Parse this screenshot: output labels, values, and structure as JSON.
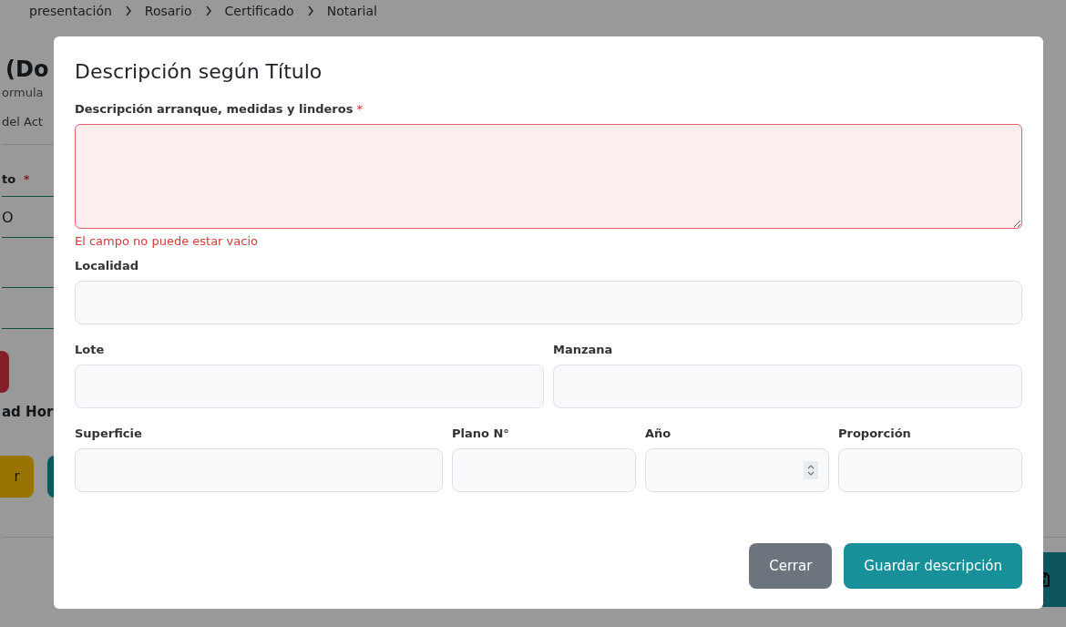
{
  "background_page": {
    "breadcrumb": [
      "presentación",
      "Rosario",
      "Certificado",
      "Notarial"
    ],
    "heading": "(Do",
    "subtitle": "ormula",
    "tab": "del Act",
    "field_label": "to",
    "field_required_mark": "*",
    "field_value": "O",
    "section_title": "ad Hor",
    "button_text": "r"
  },
  "modal": {
    "title": "Descripción según Título",
    "rows": [
      [
        {
          "label": "Descripción arranque, medidas y linderos",
          "required_mark": "*",
          "kind": "textarea",
          "invalid": true,
          "error": "El campo no puede estar vacio"
        }
      ],
      [
        {
          "label": "Localidad",
          "kind": "text",
          "invalid": false
        }
      ],
      [
        {
          "label": "Lote",
          "kind": "text",
          "invalid": false
        },
        {
          "label": "Manzana",
          "kind": "text",
          "invalid": false
        }
      ],
      [
        {
          "label": "Superficie",
          "kind": "text",
          "invalid": false
        },
        {
          "label": "Plano N°",
          "kind": "text",
          "invalid": false
        },
        {
          "label": "Año",
          "kind": "number",
          "invalid": false
        },
        {
          "label": "Proporción",
          "kind": "text",
          "invalid": false
        }
      ]
    ],
    "buttons": [
      {
        "label": "Cerrar",
        "kind": "secondary"
      },
      {
        "label": "Guardar descripción",
        "kind": "primary"
      }
    ]
  }
}
